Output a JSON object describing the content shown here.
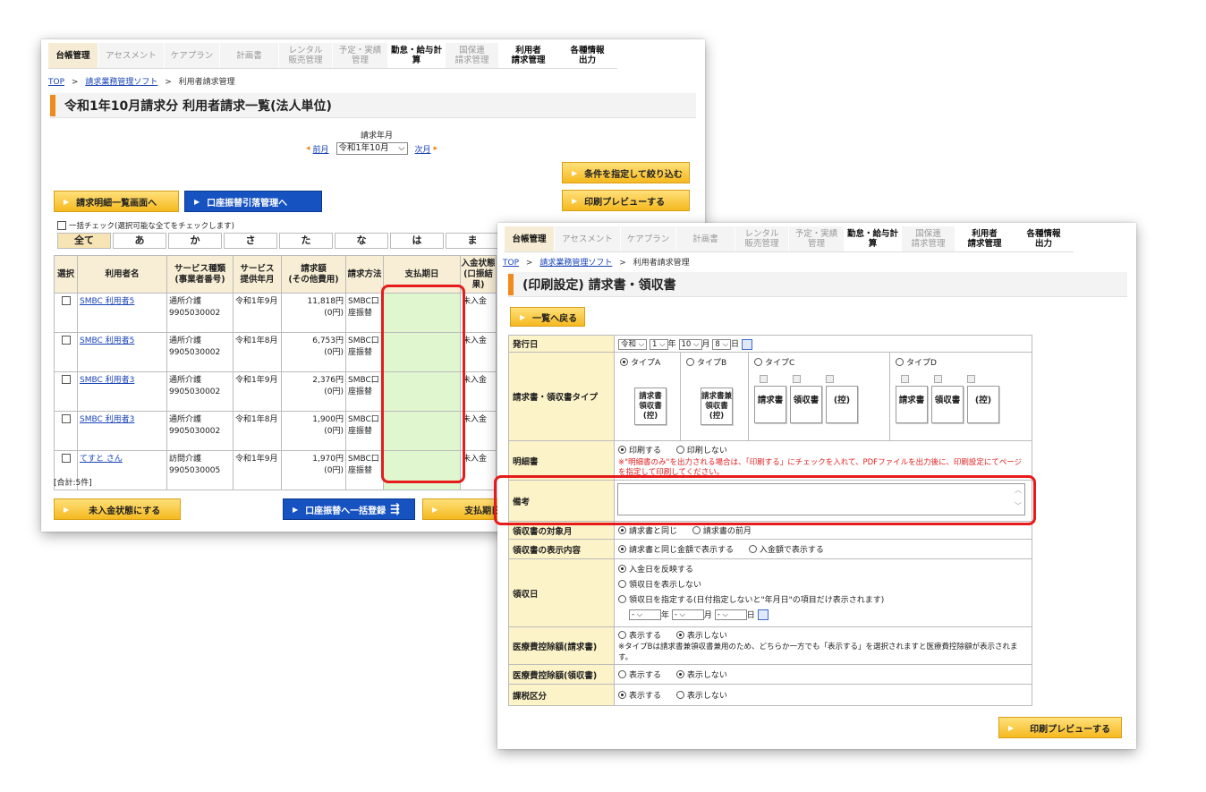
{
  "back_window": {
    "nav": {
      "tabs": [
        {
          "label": "台帳管理",
          "style": "active"
        },
        {
          "label": "アセスメント",
          "style": "dim"
        },
        {
          "label": "ケアプラン",
          "style": "dim"
        },
        {
          "label": "計画書",
          "style": "dim"
        },
        {
          "label": "レンタル\n販売管理",
          "style": "dim"
        },
        {
          "label": "予定・実績\n管理",
          "style": "dim"
        },
        {
          "label": "勤怠・給与計算",
          "style": "strong"
        },
        {
          "label": "国保連\n請求管理",
          "style": "dim"
        },
        {
          "label": "利用者\n請求管理",
          "style": "strong"
        },
        {
          "label": "各種情報\n出力",
          "style": "strong"
        }
      ]
    },
    "breadcrumb": {
      "top": "TOP",
      "sep1": ">",
      "soft": "請求業務管理ソフト",
      "sep2": ">",
      "current": "利用者請求管理"
    },
    "title": "令和1年10月請求分 利用者請求一覧(法人単位)",
    "month_picker": {
      "label": "請求年月",
      "prev": "前月",
      "value": "令和1年10月",
      "next": "次月"
    },
    "buttons": {
      "filter": "条件を指定して絞り込む",
      "preview": "印刷プレビューする",
      "usage_info": "請求明細一覧画面へ",
      "account_transfer": "口座振替引落管理へ",
      "unpaid": "未入金状態にする",
      "bulk_register": "口座振替へ一括登録",
      "pay_date": "支払期日を"
    },
    "check_all_label": "一括チェック(選択可能な全てをチェックします)",
    "kana_tabs": [
      "全て",
      "あ",
      "か",
      "さ",
      "た",
      "な",
      "は",
      "ま"
    ],
    "table": {
      "headers": [
        "選択",
        "利用者名",
        "サービス種類\n(事業者番号)",
        "サービス\n提供年月",
        "請求額\n(その他費用)",
        "請求方法",
        "支払期日",
        "入金状態\n(口振結\n果)"
      ],
      "rows": [
        {
          "name": "SMBC 利用者5",
          "service": "通所介護",
          "office": "9905030002",
          "month": "令和1年9月",
          "amount": "11,818円",
          "other": "(0円)",
          "method": "SMBC口",
          "method2": "座振替",
          "status": "未入金"
        },
        {
          "name": "SMBC 利用者5",
          "service": "通所介護",
          "office": "9905030002",
          "month": "令和1年8月",
          "amount": "6,753円",
          "other": "(0円)",
          "method": "SMBC口",
          "method2": "座振替",
          "status": "未入金"
        },
        {
          "name": "SMBC 利用者3",
          "service": "通所介護",
          "office": "9905030002",
          "month": "令和1年9月",
          "amount": "2,376円",
          "other": "(0円)",
          "method": "SMBC口",
          "method2": "座振替",
          "status": "未入金"
        },
        {
          "name": "SMBC 利用者3",
          "service": "通所介護",
          "office": "9905030002",
          "month": "令和1年8月",
          "amount": "1,900円",
          "other": "(0円)",
          "method": "SMBC口",
          "method2": "座振替",
          "status": "未入金"
        },
        {
          "name": "てすと さん",
          "service": "訪問介護",
          "office": "9905030005",
          "month": "令和1年9月",
          "amount": "1,970円",
          "other": "(0円)",
          "method": "SMBC口",
          "method2": "座振替",
          "status": "未入金"
        }
      ]
    },
    "total": "[合計:5件]"
  },
  "front_window": {
    "breadcrumb": {
      "top": "TOP",
      "sep1": ">",
      "soft": "請求業務管理ソフト",
      "sep2": ">",
      "current": "利用者請求管理"
    },
    "title": "(印刷設定) 請求書・領収書",
    "back_button": "一覧へ戻る",
    "issue_date": {
      "label": "発行日",
      "era": "令和",
      "year": "1",
      "year_unit": "年",
      "month": "10",
      "month_unit": "月",
      "day": "8",
      "day_unit": "日"
    },
    "type": {
      "label": "請求書・領収書タイプ",
      "options": [
        "タイプA",
        "タイプB",
        "タイプC",
        "タイプD"
      ],
      "selected": "タイプA",
      "a_doc": [
        "請求書",
        "領収書",
        "(控)"
      ],
      "b_doc": [
        "請求書兼",
        "領収書",
        "(控)"
      ],
      "c_docs": [
        "請求書",
        "領収書",
        "(控)"
      ],
      "d_docs": [
        "請求書",
        "領収書",
        "(控)"
      ]
    },
    "detail": {
      "label": "明細書",
      "options": [
        "印刷する",
        "印刷しない"
      ],
      "selected": "印刷する",
      "warning": "※\"明細書のみ\"を出力される場合は、「印刷する」にチェックを入れて、PDFファイルを出力後に、印刷設定にてページを指定して印刷してください。"
    },
    "remarks": {
      "label": "備考",
      "value": ""
    },
    "receipt_target": {
      "label": "領収書の対象月",
      "options": [
        "請求書と同じ",
        "請求書の前月"
      ],
      "selected": "請求書と同じ"
    },
    "receipt_display": {
      "label": "領収書の表示内容",
      "options": [
        "請求書と同じ金額で表示する",
        "入金額で表示する"
      ],
      "selected": "請求書と同じ金額で表示する"
    },
    "receipt_date": {
      "label": "領収日",
      "options": [
        "入金日を反映する",
        "領収日を表示しない",
        "領収日を指定する(日付指定しないと\"年月日\"の項目だけ表示されます)"
      ],
      "selected": "入金日を反映する",
      "year": "-",
      "year_unit": "年",
      "month": "-",
      "month_unit": "月",
      "day": "-",
      "day_unit": "日"
    },
    "medical_invoice": {
      "label": "医療費控除額(請求書)",
      "options": [
        "表示する",
        "表示しない"
      ],
      "selected": "表示しない",
      "note": "※タイプBは請求書兼領収書兼用のため、どちらか一方でも「表示する」を選択されますと医療費控除額が表示されます。"
    },
    "medical_receipt": {
      "label": "医療費控除額(領収書)",
      "options": [
        "表示する",
        "表示しない"
      ],
      "selected": "表示しない"
    },
    "tax": {
      "label": "課税区分",
      "options": [
        "表示する",
        "表示しない"
      ],
      "selected": "表示する"
    },
    "preview_button": "印刷プレビューする"
  }
}
